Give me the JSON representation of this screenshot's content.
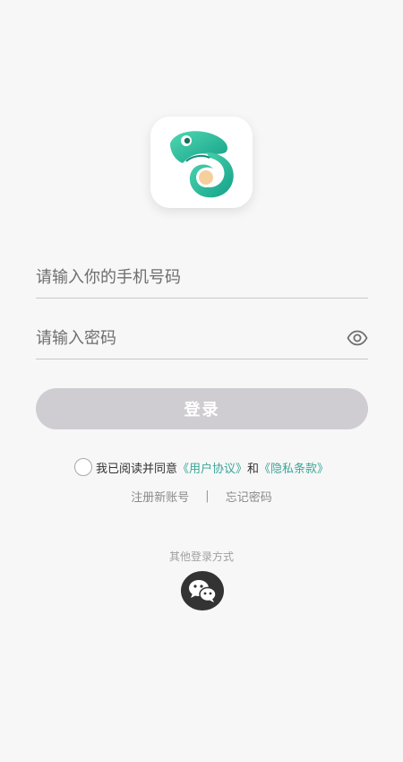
{
  "app": {
    "logo_icon": "chameleon-logo-icon",
    "brand_green": "#2fc39a",
    "brand_teal": "#17a08a"
  },
  "form": {
    "phone_placeholder": "请输入你的手机号码",
    "password_placeholder": "请输入密码",
    "password_toggle_icon": "eye-icon",
    "login_label": "登录"
  },
  "agreement": {
    "checked": false,
    "prefix": "我已阅读并同意",
    "user_agreement": "《用户协议》",
    "conjunction": "和",
    "privacy_policy": "《隐私条款》",
    "link_color": "#3aa79a"
  },
  "links": {
    "register": "注册新账号",
    "separator": "|",
    "forgot_password": "忘记密码"
  },
  "other_login": {
    "label": "其他登录方式",
    "wechat_icon": "wechat-icon"
  }
}
